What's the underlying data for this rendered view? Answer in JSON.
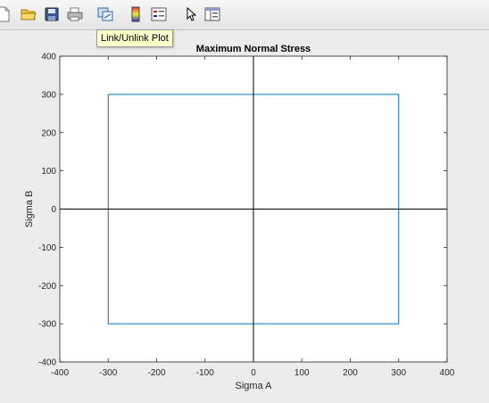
{
  "toolbar": {
    "tooltip": "Link/Unlink Plot",
    "buttons": [
      {
        "name": "new-figure-button",
        "icon": "new-file-icon"
      },
      {
        "name": "open-file-button",
        "icon": "folder-icon"
      },
      {
        "name": "save-button",
        "icon": "floppy-disk-icon"
      },
      {
        "name": "print-button",
        "icon": "printer-icon"
      },
      {
        "name": "link-unlink-plot-button",
        "icon": "link-plot-icon"
      },
      {
        "name": "insert-colorbar-button",
        "icon": "colorbar-icon"
      },
      {
        "name": "insert-legend-button",
        "icon": "legend-icon"
      },
      {
        "name": "edit-plot-button",
        "icon": "pointer-arrow-icon"
      },
      {
        "name": "show-plot-tools-button",
        "icon": "plot-tools-icon"
      }
    ]
  },
  "chart_data": {
    "type": "line",
    "title": "Maximum Normal Stress",
    "xlabel": "Sigma A",
    "ylabel": "Sigma B",
    "xlim": [
      -400,
      400
    ],
    "ylim": [
      -400,
      400
    ],
    "xticks": [
      -400,
      -300,
      -200,
      -100,
      0,
      100,
      200,
      300,
      400
    ],
    "yticks": [
      -400,
      -300,
      -200,
      -100,
      0,
      100,
      200,
      300,
      400
    ],
    "grid": false,
    "series": [
      {
        "color": "#0072BD",
        "x": [
          -300,
          300,
          300,
          -300,
          -300
        ],
        "y": [
          300,
          300,
          -300,
          -300,
          300
        ]
      },
      {
        "color": "#000000",
        "x": [
          -400,
          400
        ],
        "y": [
          0,
          0
        ]
      },
      {
        "color": "#000000",
        "x": [
          0,
          0
        ],
        "y": [
          -400,
          400
        ]
      }
    ]
  }
}
